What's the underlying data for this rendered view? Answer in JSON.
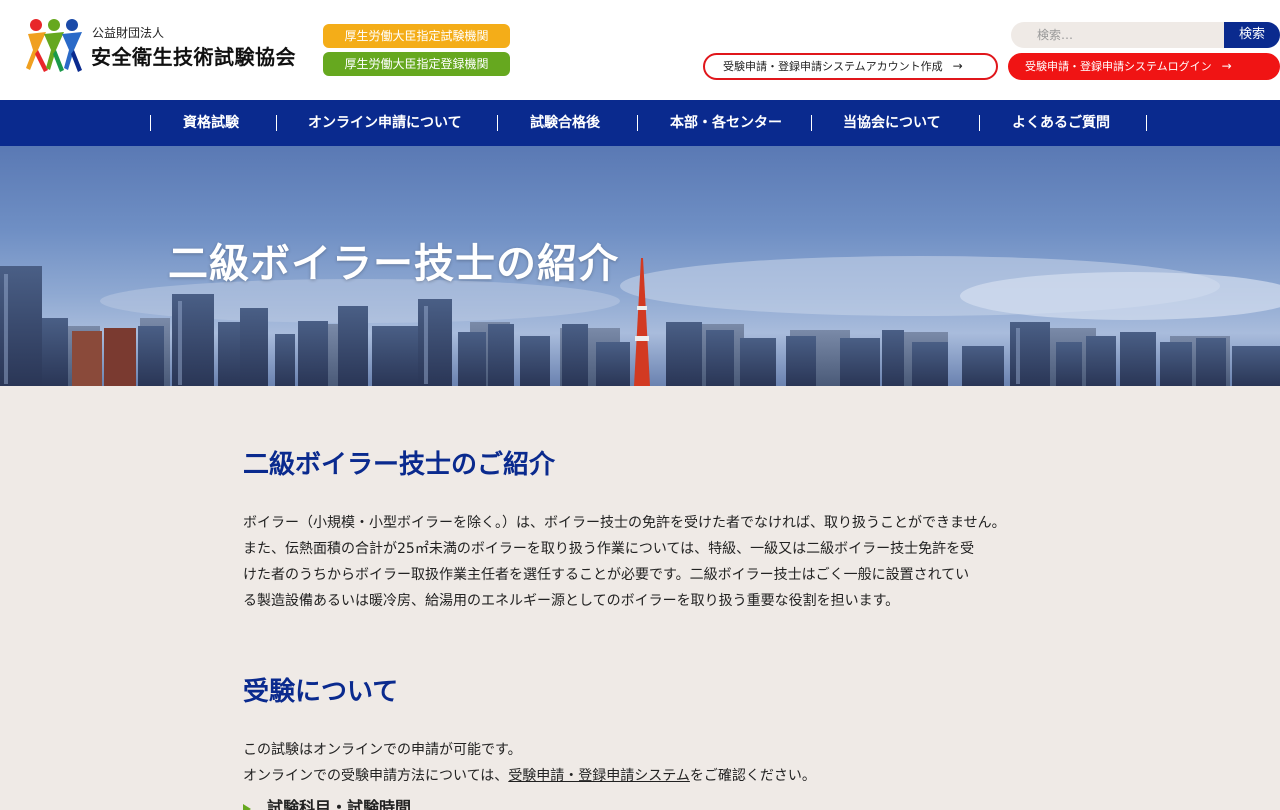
{
  "header": {
    "org_small": "公益財団法人",
    "org_name": "安全衛生技術試験協会",
    "badge_exam": "厚生労働大臣指定試験機関",
    "badge_register": "厚生労働大臣指定登録機関",
    "search_placeholder": "検索…",
    "search_button": "検索",
    "account_button": "受験申請・登録申請システムアカウント作成",
    "login_button": "受験申請・登録申請システムログイン",
    "arrow": "→"
  },
  "nav": {
    "items": [
      {
        "label": "資格試験"
      },
      {
        "label": "オンライン申請について"
      },
      {
        "label": "試験合格後"
      },
      {
        "label": "本部・各センター"
      },
      {
        "label": "当協会について"
      },
      {
        "label": "よくあるご質問"
      }
    ]
  },
  "hero": {
    "title": "二級ボイラー技士の紹介"
  },
  "main": {
    "section1_title": "二級ボイラー技士のご紹介",
    "section1_lines": [
      "ボイラー（小規模・小型ボイラーを除く。）は、ボイラー技士の免許を受けた者でなければ、取り扱うことができません。",
      "また、伝熱面積の合計が25㎡未満のボイラーを取り扱う作業については、特級、一級又は二級ボイラー技士免許を受",
      "けた者のうちからボイラー取扱作業主任者を選任することが必要です。二級ボイラー技士はごく一般に設置されてい",
      "る製造設備あるいは暖冷房、給湯用のエネルギー源としてのボイラーを取り扱う重要な役割を担います。"
    ],
    "section2_title": "受験について",
    "online_line1": "この試験はオンラインでの申請が可能です。",
    "online_line2_prefix": "オンラインでの受験申請方法については、",
    "online_line2_link": "受験申請・登録申請システム",
    "online_line2_suffix": "をご確認ください。",
    "subsection_title": "試験科目・試験時間"
  },
  "colors": {
    "brand_navy": "#0a2a8e",
    "badge_orange": "#f4ad18",
    "badge_green": "#66a81f",
    "login_red": "#f01414",
    "page_bg": "#efeae6"
  }
}
